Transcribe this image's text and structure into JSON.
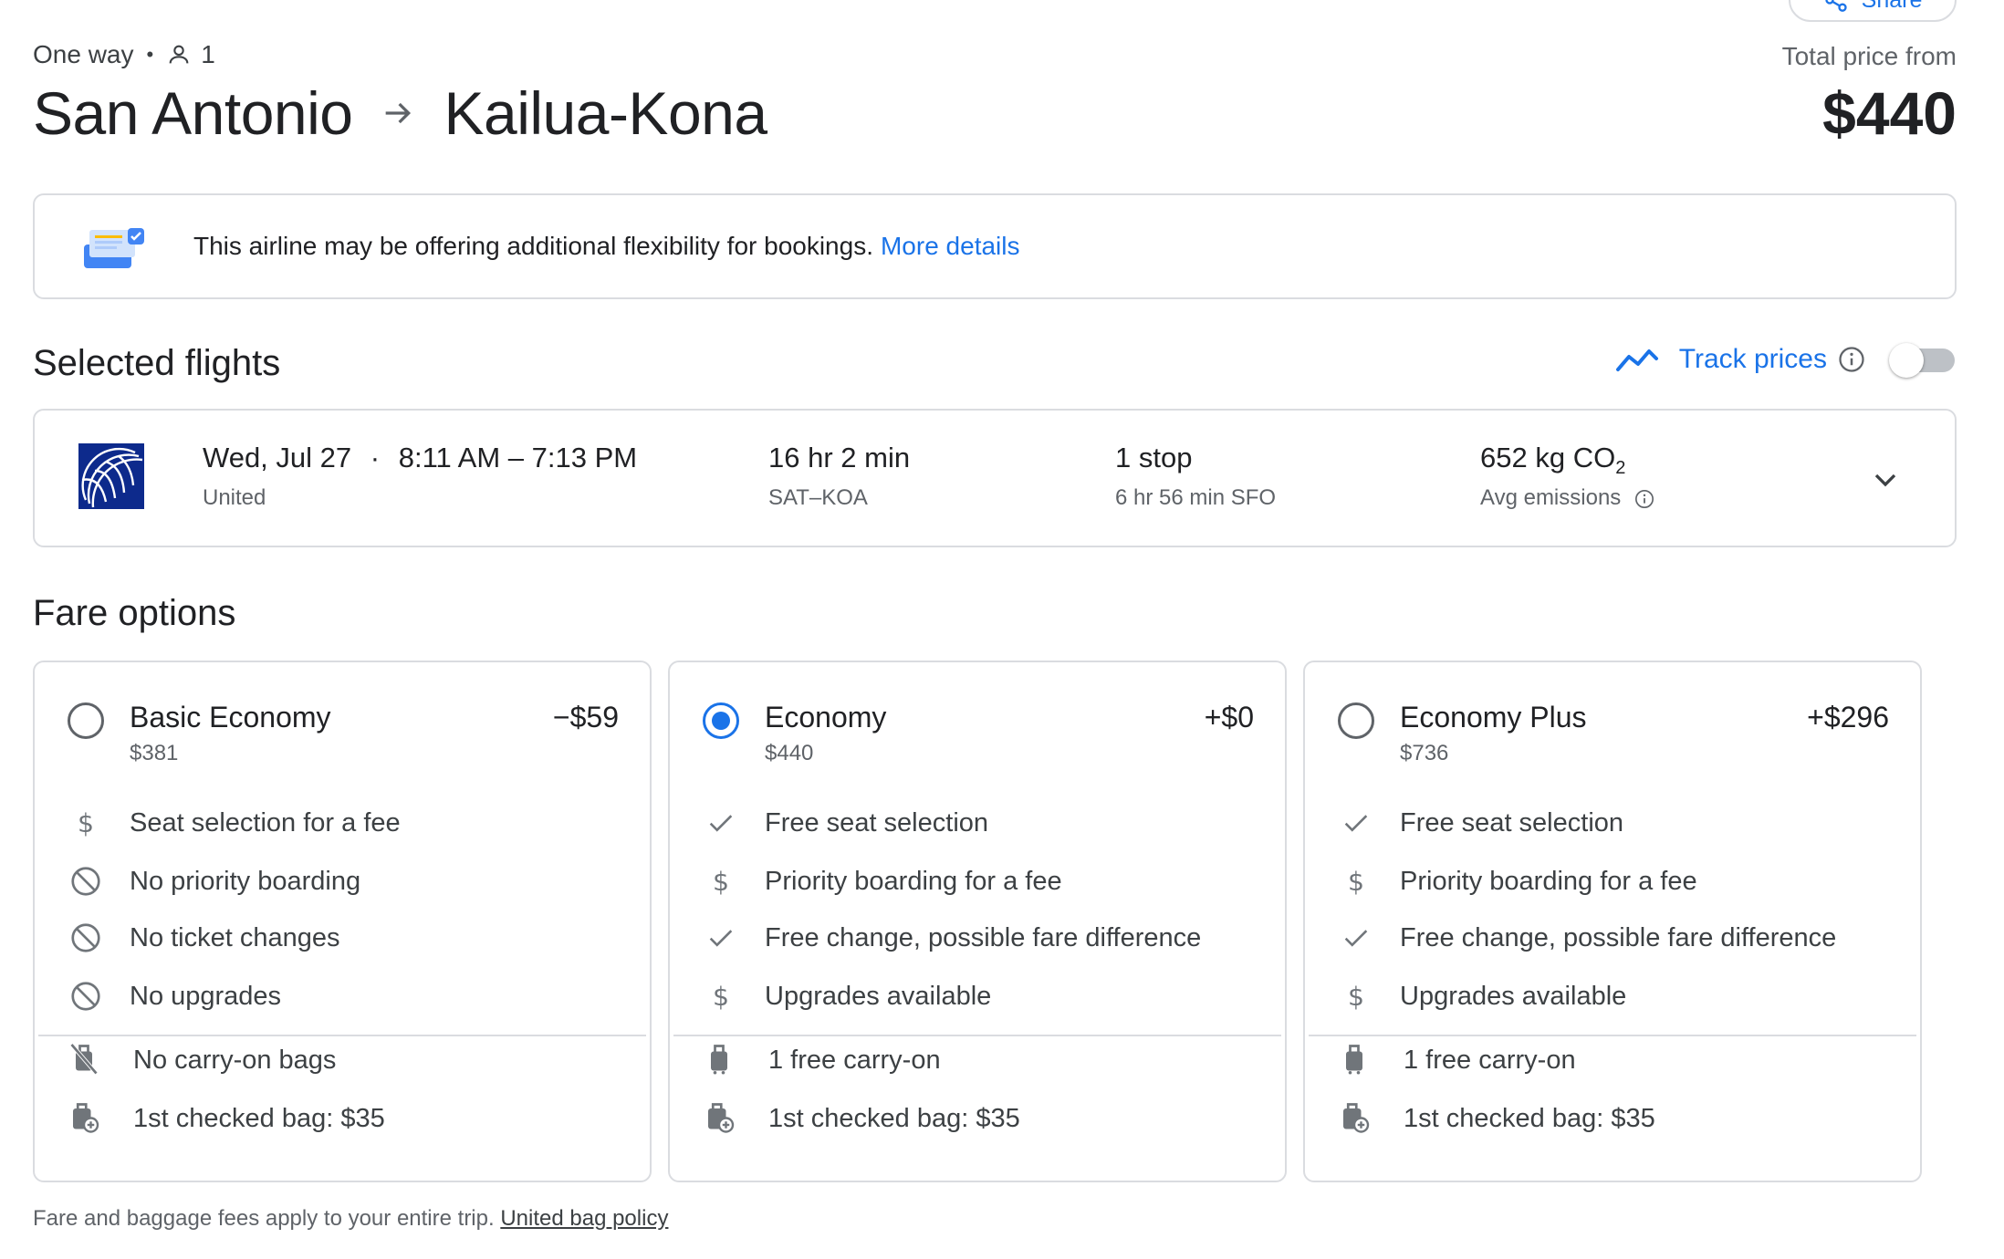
{
  "share": {
    "label": "Share",
    "icon": "share-icon"
  },
  "trip": {
    "type": "One way",
    "passengers": "1",
    "origin": "San Antonio",
    "destination": "Kailua-Kona"
  },
  "price": {
    "label": "Total price from",
    "amount": "$440"
  },
  "banner": {
    "text": "This airline may be offering additional flexibility for bookings.",
    "link": "More details"
  },
  "selected_flights": {
    "title": "Selected flights",
    "track_label": "Track prices",
    "track_on": false,
    "flight": {
      "date": "Wed, Jul 27",
      "times": "8:11 AM – 7:13 PM",
      "airline": "United",
      "duration": "16 hr 2 min",
      "route": "SAT–KOA",
      "stops": "1 stop",
      "layover": "6 hr 56 min SFO",
      "emissions_value": "652 kg CO",
      "emissions_sub": "2",
      "emissions_label": "Avg emissions"
    }
  },
  "fare_options": {
    "title": "Fare options",
    "selected_index": 1,
    "fares": [
      {
        "name": "Basic Economy",
        "price": "$381",
        "delta": "−$59",
        "selected": false,
        "features": [
          {
            "icon": "dollar-icon",
            "text": "Seat selection for a fee"
          },
          {
            "icon": "block-icon",
            "text": "No priority boarding"
          },
          {
            "icon": "block-icon",
            "text": "No ticket changes"
          },
          {
            "icon": "block-icon",
            "text": "No upgrades"
          }
        ],
        "bags": [
          {
            "icon": "no-carry-on-icon",
            "text": "No carry-on bags"
          },
          {
            "icon": "checked-bag-icon",
            "text": "1st checked bag: $35"
          }
        ]
      },
      {
        "name": "Economy",
        "price": "$440",
        "delta": "+$0",
        "selected": true,
        "features": [
          {
            "icon": "check-icon",
            "text": "Free seat selection"
          },
          {
            "icon": "dollar-icon",
            "text": "Priority boarding for a fee"
          },
          {
            "icon": "check-icon",
            "text": "Free change, possible fare difference"
          },
          {
            "icon": "dollar-icon",
            "text": "Upgrades available"
          }
        ],
        "bags": [
          {
            "icon": "carry-on-icon",
            "text": "1 free carry-on"
          },
          {
            "icon": "checked-bag-icon",
            "text": "1st checked bag: $35"
          }
        ]
      },
      {
        "name": "Economy Plus",
        "price": "$736",
        "delta": "+$296",
        "selected": false,
        "features": [
          {
            "icon": "check-icon",
            "text": "Free seat selection"
          },
          {
            "icon": "dollar-icon",
            "text": "Priority boarding for a fee"
          },
          {
            "icon": "check-icon",
            "text": "Free change, possible fare difference"
          },
          {
            "icon": "dollar-icon",
            "text": "Upgrades available"
          }
        ],
        "bags": [
          {
            "icon": "carry-on-icon",
            "text": "1 free carry-on"
          },
          {
            "icon": "checked-bag-icon",
            "text": "1st checked bag: $35"
          }
        ]
      }
    ]
  },
  "footer": {
    "text": "Fare and baggage fees apply to your entire trip.",
    "link": "United bag policy"
  },
  "colors": {
    "accent": "#1a73e8",
    "text": "#202124",
    "muted": "#5f6368",
    "border": "#dadce0"
  }
}
